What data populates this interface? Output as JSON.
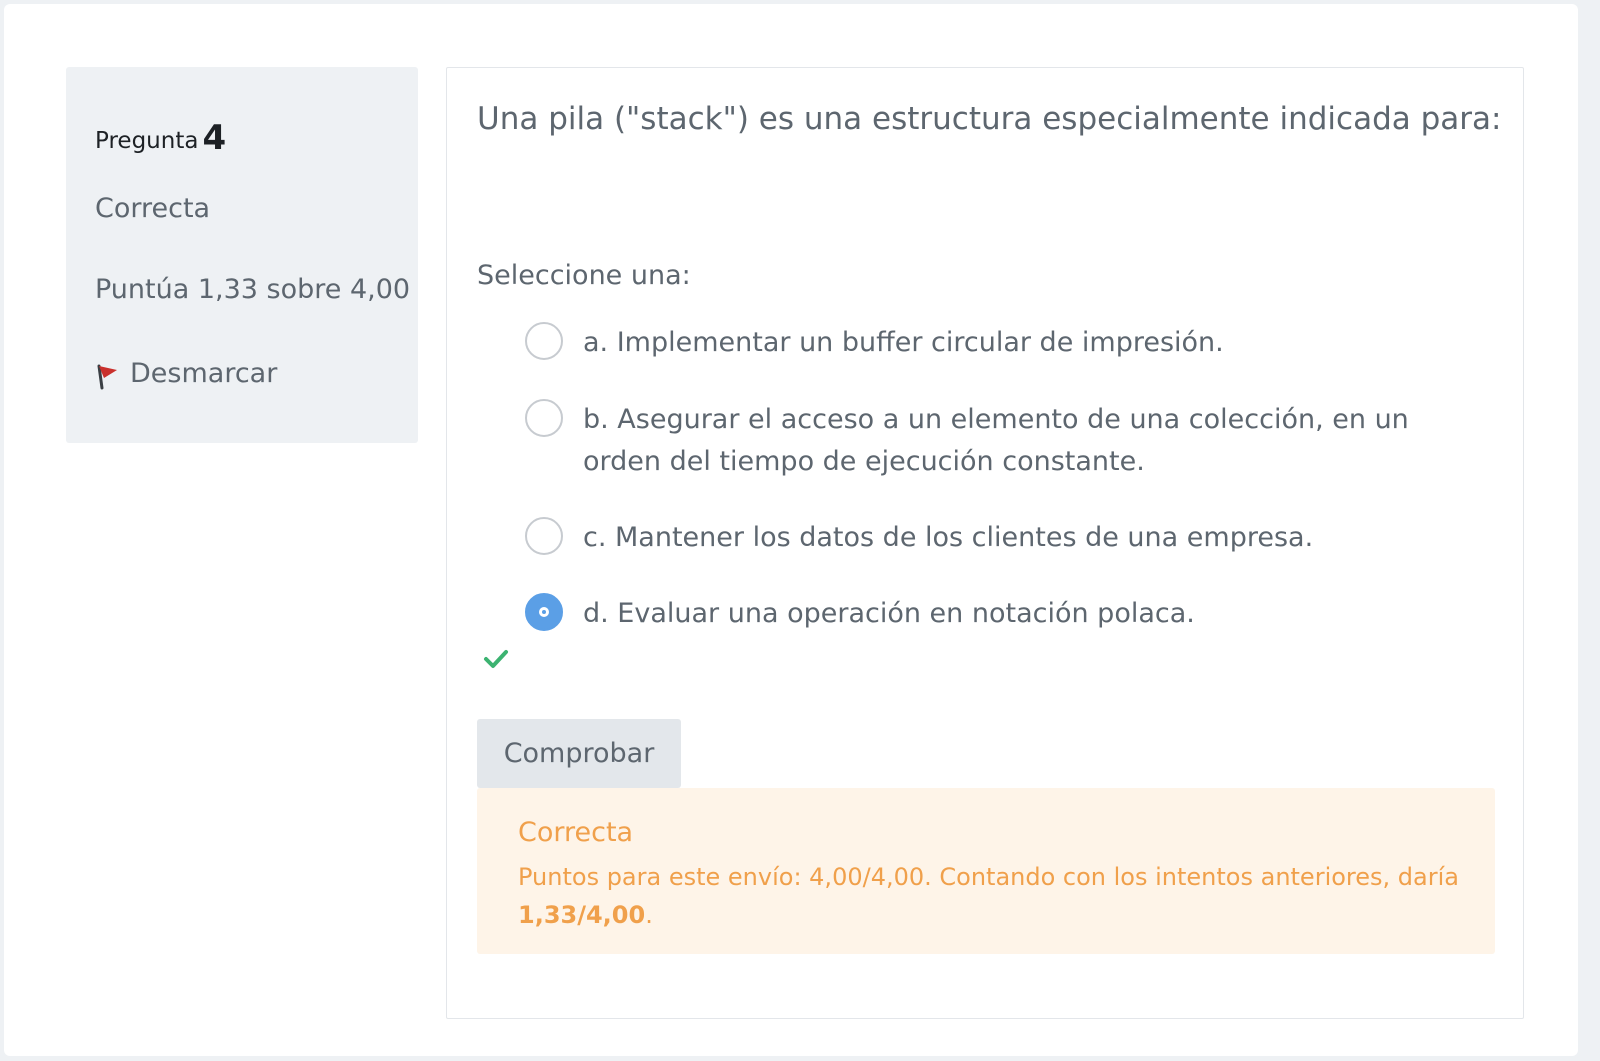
{
  "question_info": {
    "label": "Pregunta",
    "number": "4",
    "state": "Correcta",
    "grade": "Puntúa 1,33 sobre 4,00",
    "flag_label": "Desmarcar"
  },
  "question": {
    "text": "Una pila (\"stack\") es una estructura especialmente indicada para:",
    "prompt": "Seleccione una:",
    "answers": [
      {
        "label": "a. Implementar un buffer circular de impresión.",
        "checked": false
      },
      {
        "label": "b. Asegurar el acceso a un elemento de una colección, en un orden del tiempo de ejecución constante.",
        "checked": false
      },
      {
        "label": "c. Mantener los datos de los clientes de una empresa.",
        "checked": false
      },
      {
        "label": "d. Evaluar una operación en notación polaca.",
        "checked": true
      }
    ],
    "check_button": "Comprobar"
  },
  "feedback": {
    "title": "Correcta",
    "text_prefix": "Puntos para este envío: 4,00/4,00. Contando con los intentos anteriores, daría ",
    "grade_bold": "1,33/4,00",
    "text_suffix": "."
  },
  "colors": {
    "radio_checked": "#5b9fe6",
    "correct_icon": "#3cb371",
    "feedback_bg": "#fef4e8",
    "feedback_text": "#f0a04b",
    "flag": "#c9302c"
  },
  "icons": {
    "flag": "flag-icon",
    "correct": "checkmark-icon"
  }
}
